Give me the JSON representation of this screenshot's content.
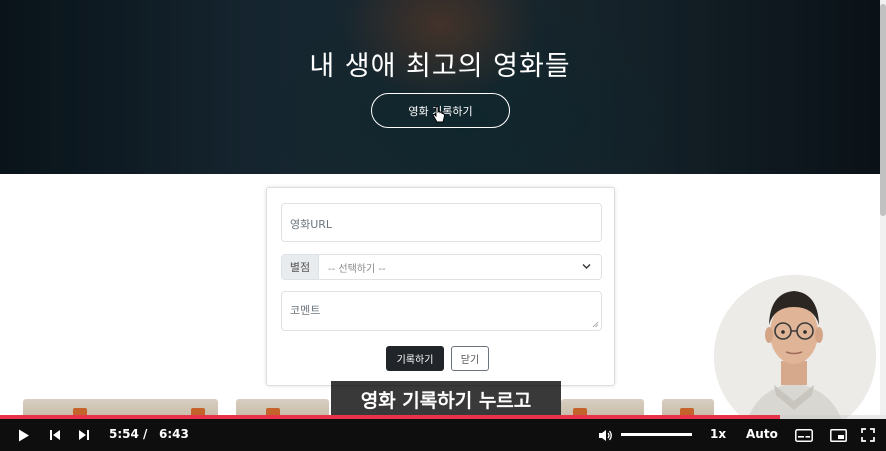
{
  "hero": {
    "title": "내 생애 최고의 영화들",
    "record_button": "영화 기록하기"
  },
  "form": {
    "url_placeholder": "영화URL",
    "rating_label": "별점",
    "rating_selected": "-- 선택하기 --",
    "comment_placeholder": "코멘트",
    "save_button": "기록하기",
    "close_button": "닫기"
  },
  "subtitle": "영화 기록하기 누르고",
  "player": {
    "current_time": "5:54",
    "separator": "/",
    "duration": "6:43",
    "progress_fraction": 0.88,
    "volume_fraction": 1.0,
    "speed": "1x",
    "quality": "Auto"
  },
  "colors": {
    "progress": "#e8344a",
    "dark_button": "#212529"
  }
}
